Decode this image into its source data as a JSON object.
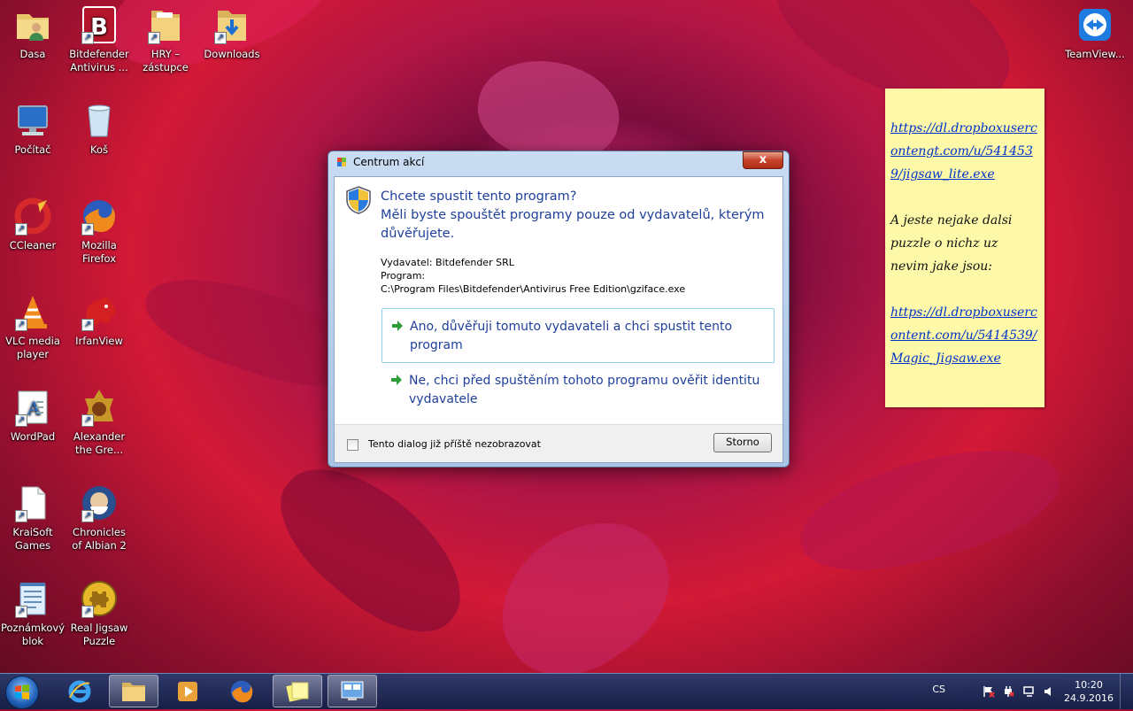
{
  "desktop": {
    "icons": [
      {
        "id": "dasa",
        "label": "Dasa"
      },
      {
        "id": "bitdefender",
        "label": "Bitdefender Antivirus ..."
      },
      {
        "id": "hry",
        "label": "HRY – zástupce"
      },
      {
        "id": "downloads",
        "label": "Downloads"
      },
      {
        "id": "teamviewer",
        "label": "TeamView..."
      },
      {
        "id": "pocitac",
        "label": "Počítač"
      },
      {
        "id": "kos",
        "label": "Koš"
      },
      {
        "id": "ccleaner",
        "label": "CCleaner"
      },
      {
        "id": "firefox",
        "label": "Mozilla Firefox"
      },
      {
        "id": "vlc",
        "label": "VLC media player"
      },
      {
        "id": "irfanview",
        "label": "IrfanView"
      },
      {
        "id": "wordpad",
        "label": "WordPad"
      },
      {
        "id": "alexander",
        "label": "Alexander the Gre..."
      },
      {
        "id": "kraisoft",
        "label": "KraiSoft Games"
      },
      {
        "id": "albian",
        "label": "Chronicles of Albian 2"
      },
      {
        "id": "poznamkovy",
        "label": "Poznámkový blok"
      },
      {
        "id": "jigsaw",
        "label": "Real Jigsaw Puzzle"
      }
    ]
  },
  "note": {
    "link1": "https://dl.dropboxusercontengt.com/u/5414539/jigsaw_lite.exe",
    "text": "A jeste nejake dalsi puzzle o nichz uz nevim jake jsou:",
    "link2": "https://dl.dropboxusercontent.com/u/5414539/Magic_Jigsaw.exe"
  },
  "dialog": {
    "title": "Centrum akcí",
    "close": "x",
    "question": "Chcete spustit tento program?",
    "subtitle": "Měli byste spouštět programy pouze od vydavatelů, kterým důvěřujete.",
    "publisher": "Vydavatel: Bitdefender SRL",
    "program_label": "Program:",
    "program_path": "C:\\Program Files\\Bitdefender\\Antivirus Free Edition\\gziface.exe",
    "option_yes": "Ano, důvěřuji tomuto vydavateli a chci spustit tento program",
    "option_no": "Ne, chci před spuštěním tohoto programu ověřit identitu vydavatele",
    "checkbox_label": "Tento dialog již příště nezobrazovat",
    "cancel": "Storno"
  },
  "taskbar": {
    "language": "CS",
    "time": "10:20",
    "date": "24.9.2016",
    "buttons": [
      "internet-explorer",
      "explorer",
      "media-center",
      "firefox",
      "sticky-notes",
      "action-center"
    ]
  }
}
